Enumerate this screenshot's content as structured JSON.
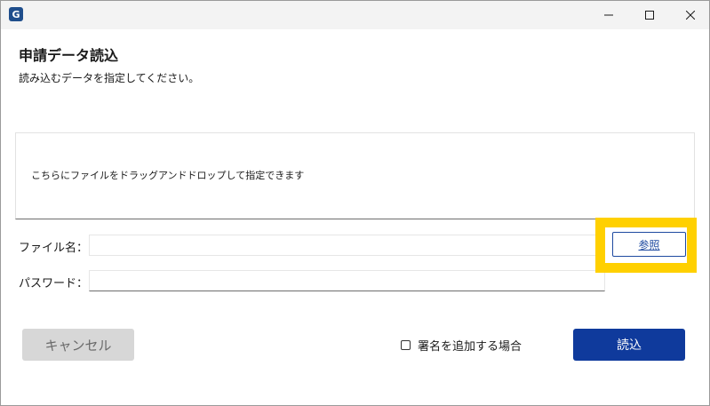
{
  "window": {
    "app_icon_letter": "G",
    "controls": [
      "minimize",
      "maximize",
      "close"
    ]
  },
  "dialog": {
    "title": "申請データ読込",
    "subtitle": "読み込むデータを指定してください。"
  },
  "dropzone": {
    "text": "こちらにファイルをドラッグアンドドロップして指定できます"
  },
  "form": {
    "file_label": "ファイル名：",
    "file_value": "",
    "password_label": "パスワード：",
    "password_value": "",
    "browse_label": "参照"
  },
  "footer": {
    "cancel_label": "キャンセル",
    "signature_checkbox_label": "署名を追加する場合",
    "signature_checked": false,
    "load_label": "読込"
  },
  "colors": {
    "highlight": "#ffd000",
    "primary": "#0f3a9c",
    "disabled": "#d7d7d7"
  }
}
